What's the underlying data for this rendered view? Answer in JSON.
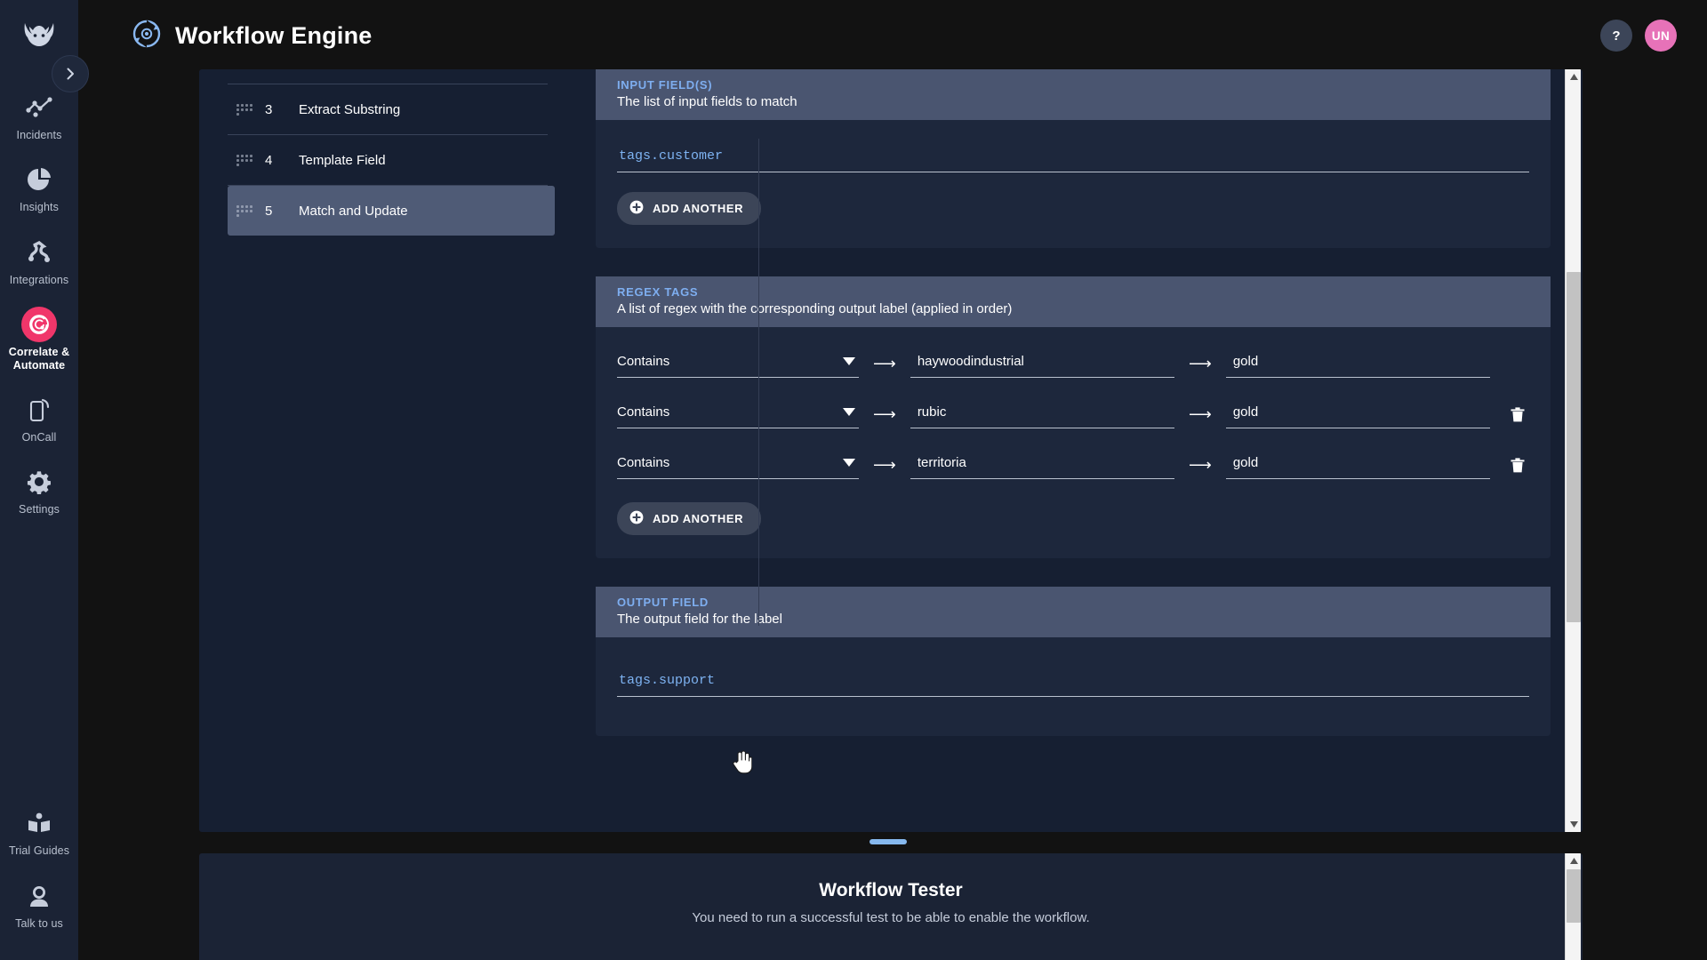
{
  "app": {
    "rail_logo_icon": "bull-logo-icon",
    "expand_icon": "chevron-right-icon",
    "items": [
      {
        "label": "Incidents",
        "icon": "incidents-icon",
        "active": false
      },
      {
        "label": "Insights",
        "icon": "pie-chart-icon",
        "active": false
      },
      {
        "label": "Integrations",
        "icon": "integrations-icon",
        "active": false
      },
      {
        "label": "Correlate & Automate",
        "icon": "target-icon",
        "active": true
      },
      {
        "label": "OnCall",
        "icon": "mobile-ring-icon",
        "active": false
      },
      {
        "label": "Settings",
        "icon": "gear-icon",
        "active": false
      }
    ],
    "bottom_items": [
      {
        "label": "Trial Guides",
        "icon": "book-icon"
      },
      {
        "label": "Talk to us",
        "icon": "support-agent-icon"
      }
    ],
    "accent_active": "#f0366a",
    "rail_bg": "#1b2335"
  },
  "header": {
    "logo_icon": "workflow-engine-icon",
    "title": "Workflow Engine",
    "help_label": "?",
    "help_icon": "question-mark-icon",
    "avatar_initials": "UN"
  },
  "steps": {
    "rows": [
      {
        "num": "3",
        "name": "Extract Substring",
        "selected": false
      },
      {
        "num": "4",
        "name": "Template Field",
        "selected": false
      },
      {
        "num": "5",
        "name": "Match and Update",
        "selected": true
      }
    ],
    "drag_handle_icon": "drag-handle-icon"
  },
  "properties": {
    "input_fields": {
      "title": "INPUT FIELD(S)",
      "description": "The list of input fields to match",
      "value": "tags.customer",
      "add_label": "ADD ANOTHER",
      "add_icon": "plus-circle-icon"
    },
    "regex_tags": {
      "title": "REGEX TAGS",
      "description": "A list of regex with the corresponding output label (applied in order)",
      "arrow_icon": "arrow-right-icon",
      "caret_icon": "chevron-down-icon",
      "delete_icon": "trash-icon",
      "add_label": "ADD ANOTHER",
      "add_icon": "plus-circle-icon",
      "rows": [
        {
          "operator": "Contains",
          "pattern": "haywoodindustrial",
          "label": "gold",
          "deletable": false
        },
        {
          "operator": "Contains",
          "pattern": "rubic",
          "label": "gold",
          "deletable": true
        },
        {
          "operator": "Contains",
          "pattern": "territoria",
          "label": "gold",
          "deletable": true
        }
      ]
    },
    "output_field": {
      "title": "OUTPUT FIELD",
      "description": "The output field for the label",
      "value": "tags.support"
    }
  },
  "tester": {
    "title": "Workflow Tester",
    "subtitle": "You need to run a successful test to be able to enable the workflow.",
    "grabber_icon": "resize-handle-icon"
  },
  "scrollbars": {
    "editor_scroll_icon": "vertical-scrollbar",
    "tester_scroll_icon": "vertical-scrollbar"
  },
  "cursor": {
    "icon": "pointing-hand-cursor"
  }
}
